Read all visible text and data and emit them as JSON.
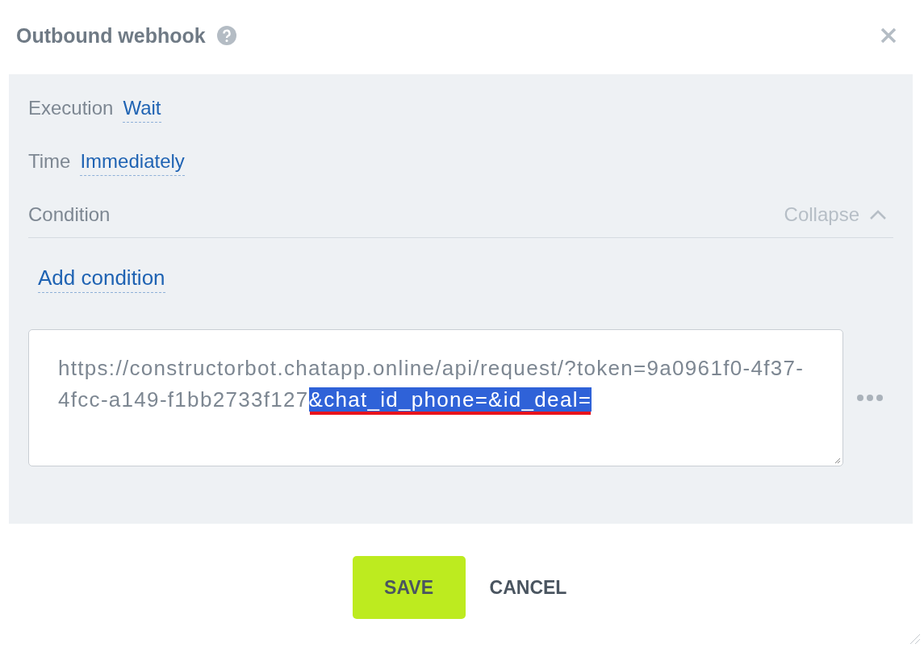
{
  "dialog": {
    "title": "Outbound webhook"
  },
  "settings": [
    {
      "label": "Execution",
      "value": "Wait"
    },
    {
      "label": "Time",
      "value": "Immediately"
    }
  ],
  "condition": {
    "label": "Condition",
    "toggle": "Collapse",
    "expanded": true,
    "add_link": "Add condition"
  },
  "url_field": {
    "segments": [
      {
        "text": "https://constructorbot.chatapp.online/api/request/?token=9a0961f0-4f37-4fcc-a149-f1bb2733f127",
        "selected": false,
        "underlined": false
      },
      {
        "text": "&chat_id_phone=&id_deal=",
        "selected": true,
        "underlined": true
      }
    ]
  },
  "buttons": [
    {
      "label": "SAVE",
      "kind": "primary"
    },
    {
      "label": "CANCEL",
      "kind": "plain"
    }
  ]
}
